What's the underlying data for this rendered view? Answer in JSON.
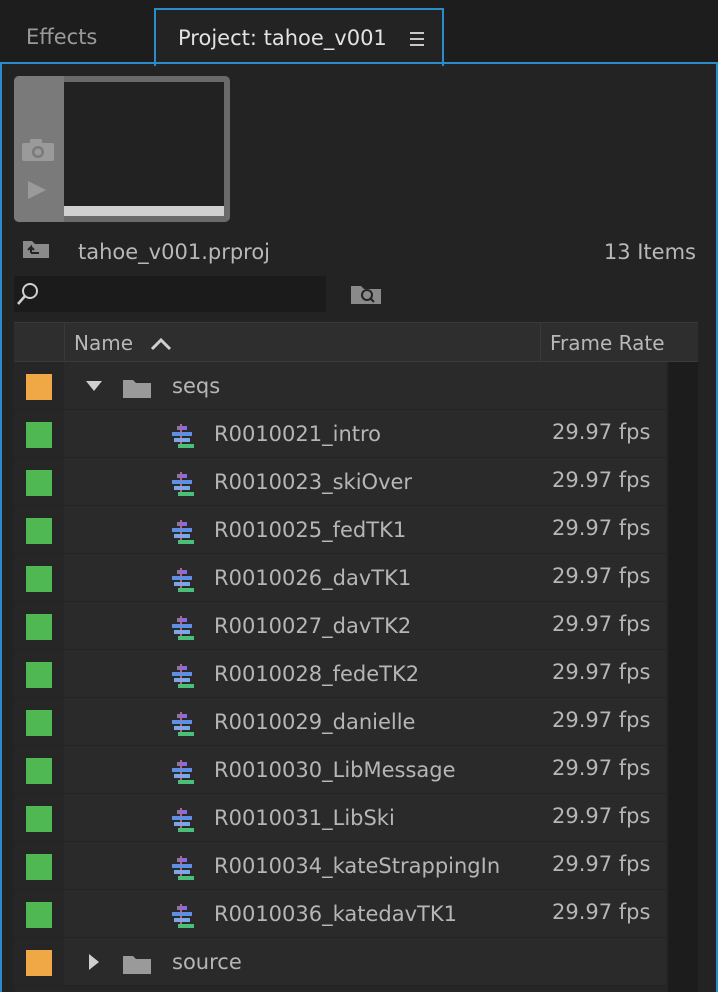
{
  "tabs": {
    "effects": "Effects",
    "project": "Project: tahoe_v001"
  },
  "project": {
    "filename": "tahoe_v001.prproj",
    "item_count": "13 Items"
  },
  "search": {
    "placeholder": "",
    "value": ""
  },
  "columns": {
    "name": "Name",
    "frame_rate": "Frame Rate"
  },
  "colors": {
    "accent": "#2b8cca",
    "bin_label": "#f0a847",
    "sequence_label": "#4fb853"
  },
  "rows": [
    {
      "kind": "bin",
      "expanded": true,
      "name": "seqs",
      "fps": "",
      "label_color": "#f0a847"
    },
    {
      "kind": "sequence",
      "name": "R0010021_intro",
      "fps": "29.97 fps",
      "label_color": "#4fb853"
    },
    {
      "kind": "sequence",
      "name": "R0010023_skiOver",
      "fps": "29.97 fps",
      "label_color": "#4fb853"
    },
    {
      "kind": "sequence",
      "name": "R0010025_fedTK1",
      "fps": "29.97 fps",
      "label_color": "#4fb853"
    },
    {
      "kind": "sequence",
      "name": "R0010026_davTK1",
      "fps": "29.97 fps",
      "label_color": "#4fb853"
    },
    {
      "kind": "sequence",
      "name": "R0010027_davTK2",
      "fps": "29.97 fps",
      "label_color": "#4fb853"
    },
    {
      "kind": "sequence",
      "name": "R0010028_fedeTK2",
      "fps": "29.97 fps",
      "label_color": "#4fb853"
    },
    {
      "kind": "sequence",
      "name": "R0010029_danielle",
      "fps": "29.97 fps",
      "label_color": "#4fb853"
    },
    {
      "kind": "sequence",
      "name": "R0010030_LibMessage",
      "fps": "29.97 fps",
      "label_color": "#4fb853"
    },
    {
      "kind": "sequence",
      "name": "R0010031_LibSki",
      "fps": "29.97 fps",
      "label_color": "#4fb853"
    },
    {
      "kind": "sequence",
      "name": "R0010034_kateStrappingIn",
      "fps": "29.97 fps",
      "label_color": "#4fb853"
    },
    {
      "kind": "sequence",
      "name": "R0010036_katedavTK1",
      "fps": "29.97 fps",
      "label_color": "#4fb853"
    },
    {
      "kind": "bin",
      "expanded": false,
      "name": "source",
      "fps": "",
      "label_color": "#f0a847"
    }
  ]
}
